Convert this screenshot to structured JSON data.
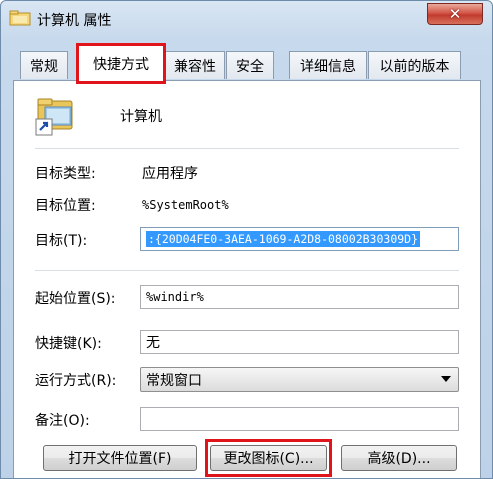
{
  "window": {
    "title": "计算机 属性",
    "close_symbol": "✕"
  },
  "tabs": [
    {
      "label": "常规",
      "active": false
    },
    {
      "label": "快捷方式",
      "active": true
    },
    {
      "label": "兼容性",
      "active": false
    },
    {
      "label": "安全",
      "active": false
    },
    {
      "label": "详细信息",
      "active": false
    },
    {
      "label": "以前的版本",
      "active": false
    }
  ],
  "shortcut": {
    "name": "计算机",
    "target_type_label": "目标类型:",
    "target_type_value": "应用程序",
    "target_location_label": "目标位置:",
    "target_location_value": "%SystemRoot%",
    "target_label": "目标(T):",
    "target_value": ":{20D04FE0-3AEA-1069-A2D8-08002B30309D}",
    "start_in_label": "起始位置(S):",
    "start_in_value": "%windir%",
    "shortcut_key_label": "快捷键(K):",
    "shortcut_key_value": "无",
    "run_label": "运行方式(R):",
    "run_value": "常规窗口",
    "comment_label": "备注(O):",
    "comment_value": ""
  },
  "buttons": {
    "open_location": "打开文件位置(F)",
    "change_icon": "更改图标(C)...",
    "advanced": "高级(D)..."
  },
  "colors": {
    "highlight": "#e0141b",
    "selection": "#3399ff"
  }
}
